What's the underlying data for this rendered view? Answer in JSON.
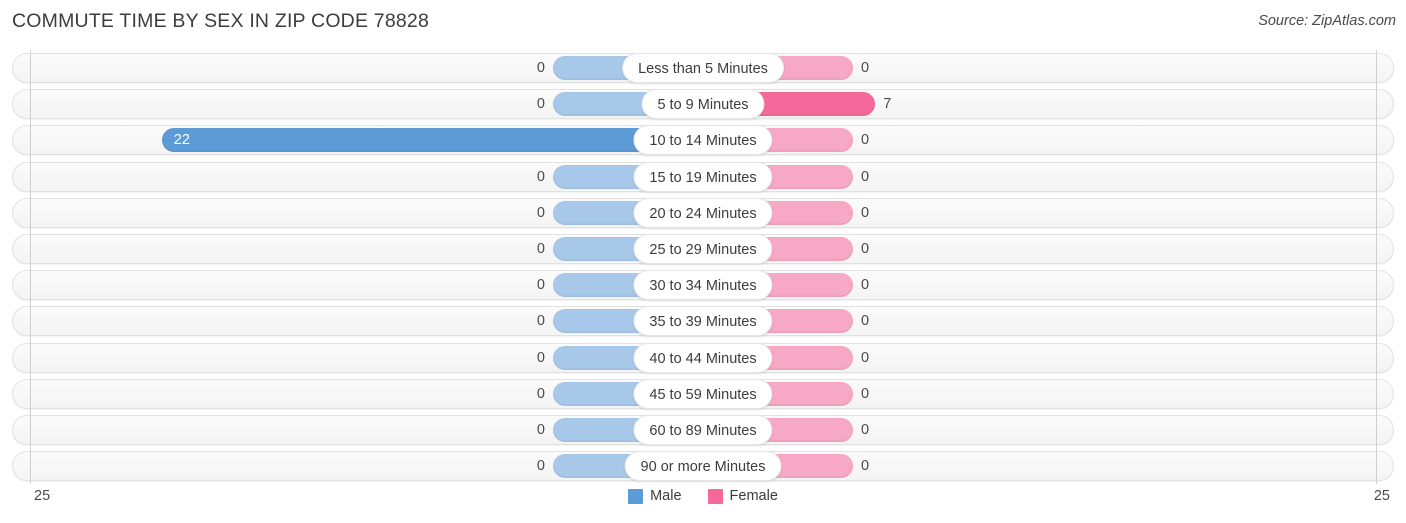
{
  "header": {
    "title": "COMMUTE TIME BY SEX IN ZIP CODE 78828",
    "source": "Source: ZipAtlas.com"
  },
  "legend": {
    "male_label": "Male",
    "female_label": "Female",
    "male_color": "#5c9bd6",
    "female_color": "#f4699a"
  },
  "axis": {
    "left_max": "25",
    "right_max": "25"
  },
  "chart_data": {
    "type": "bar",
    "subtype": "diverging-bidirectional",
    "title": "COMMUTE TIME BY SEX IN ZIP CODE 78828",
    "xlabel": "",
    "ylabel": "",
    "xlim": [
      25,
      25
    ],
    "grid": false,
    "legend_position": "bottom-center",
    "categories": [
      "Less than 5 Minutes",
      "5 to 9 Minutes",
      "10 to 14 Minutes",
      "15 to 19 Minutes",
      "20 to 24 Minutes",
      "25 to 29 Minutes",
      "30 to 34 Minutes",
      "35 to 39 Minutes",
      "40 to 44 Minutes",
      "45 to 59 Minutes",
      "60 to 89 Minutes",
      "90 or more Minutes"
    ],
    "series": [
      {
        "name": "Male",
        "direction": "left",
        "color": "#5c9bd6",
        "values": [
          0,
          0,
          22,
          0,
          0,
          0,
          0,
          0,
          0,
          0,
          0,
          0
        ]
      },
      {
        "name": "Female",
        "direction": "right",
        "color": "#f4699a",
        "values": [
          0,
          7,
          0,
          0,
          0,
          0,
          0,
          0,
          0,
          0,
          0,
          0
        ]
      }
    ]
  },
  "rows": [
    {
      "category": "Less than 5 Minutes",
      "male": "0",
      "female": "0"
    },
    {
      "category": "5 to 9 Minutes",
      "male": "0",
      "female": "7"
    },
    {
      "category": "10 to 14 Minutes",
      "male": "22",
      "female": "0"
    },
    {
      "category": "15 to 19 Minutes",
      "male": "0",
      "female": "0"
    },
    {
      "category": "20 to 24 Minutes",
      "male": "0",
      "female": "0"
    },
    {
      "category": "25 to 29 Minutes",
      "male": "0",
      "female": "0"
    },
    {
      "category": "30 to 34 Minutes",
      "male": "0",
      "female": "0"
    },
    {
      "category": "35 to 39 Minutes",
      "male": "0",
      "female": "0"
    },
    {
      "category": "40 to 44 Minutes",
      "male": "0",
      "female": "0"
    },
    {
      "category": "45 to 59 Minutes",
      "male": "0",
      "female": "0"
    },
    {
      "category": "60 to 89 Minutes",
      "male": "0",
      "female": "0"
    },
    {
      "category": "90 or more Minutes",
      "male": "0",
      "female": "0"
    }
  ]
}
